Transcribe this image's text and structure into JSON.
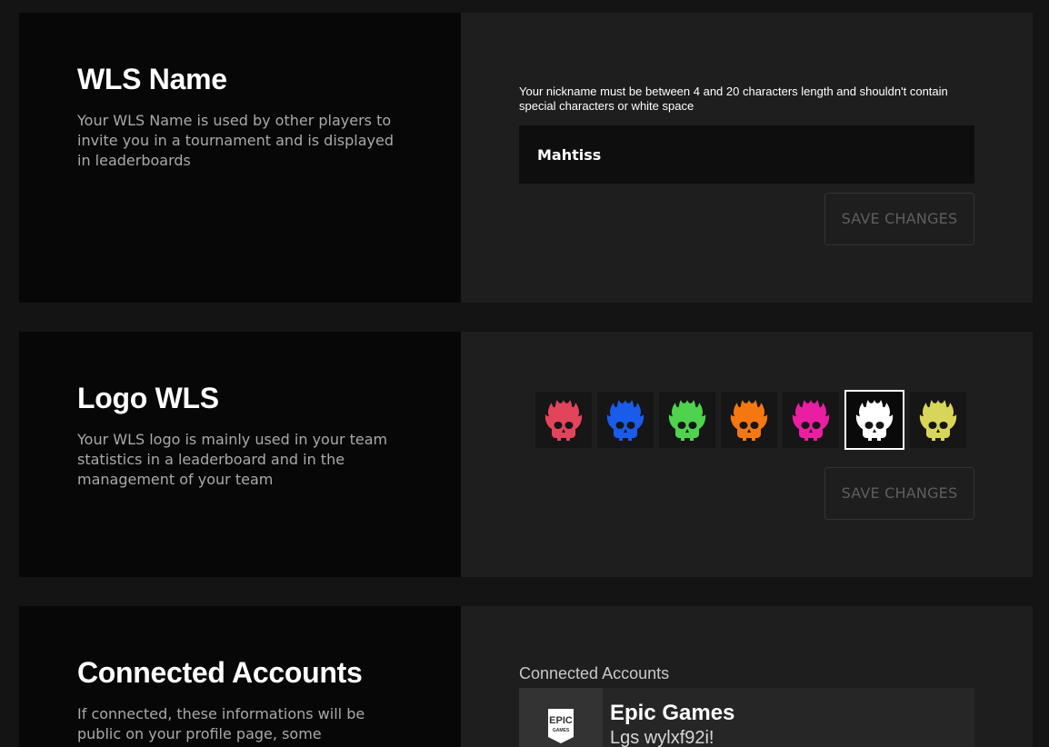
{
  "wls_name": {
    "title": "WLS Name",
    "description": "Your WLS Name is used by other players to invite you in a tournament and is displayed in leaderboards",
    "hint": "Your nickname must be between 4 and 20 characters length and shouldn't contain special characters or white space",
    "value": "Mahtiss",
    "save_label": "SAVE CHANGES"
  },
  "logo_wls": {
    "title": "Logo WLS",
    "description": "Your WLS logo is mainly used in your team statistics in a leaderboard and in the management of your team",
    "logos": [
      {
        "icon": "flaming-skull-icon",
        "color": "#e2445c"
      },
      {
        "icon": "flaming-skull-icon",
        "color": "#1a5bea"
      },
      {
        "icon": "flaming-skull-icon",
        "color": "#4fd34f"
      },
      {
        "icon": "flaming-skull-icon",
        "color": "#f57712"
      },
      {
        "icon": "flaming-skull-icon",
        "color": "#e91ea1"
      },
      {
        "icon": "flaming-skull-icon",
        "color": "#ffffff",
        "selected": true
      },
      {
        "icon": "flaming-skull-icon",
        "color": "#d8d65a"
      }
    ],
    "save_label": "SAVE CHANGES"
  },
  "connected_accounts": {
    "title": "Connected Accounts",
    "description": "If connected, these informations will be public on your profile page, some connections are",
    "label": "Connected Accounts",
    "accounts": [
      {
        "icon": "epic-games-logo",
        "logo_text_1": "EPIC",
        "logo_text_2": "GAMES",
        "name": "Epic Games",
        "id": "Lgs wylxf92i!"
      }
    ]
  }
}
